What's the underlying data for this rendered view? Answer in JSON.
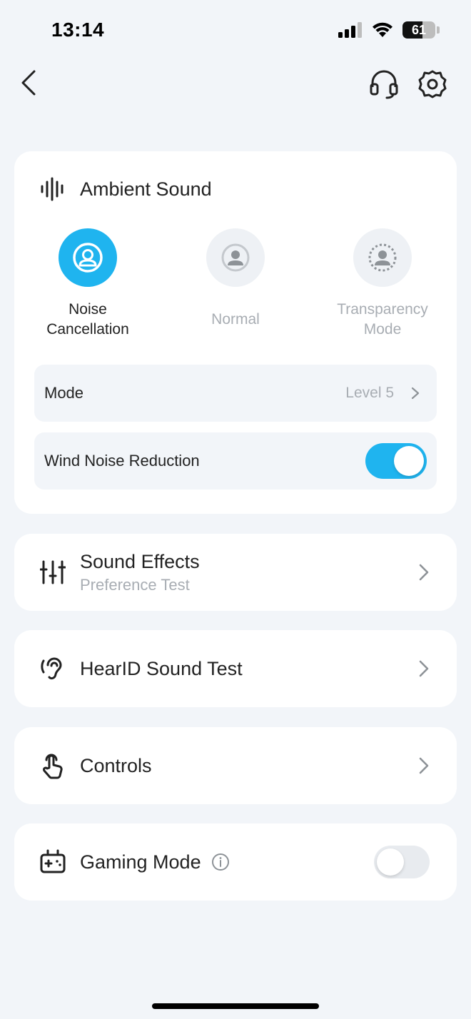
{
  "status_bar": {
    "time": "13:14",
    "battery": "61",
    "battery_level": 0.61
  },
  "nav": {
    "back_icon": "chevron-left-icon",
    "headset_icon": "headset-icon",
    "settings_icon": "gear-icon"
  },
  "ambient": {
    "title": "Ambient Sound",
    "modes": [
      {
        "line1": "Noise",
        "line2": "Cancellation",
        "selected": true
      },
      {
        "line1": "Normal",
        "line2": "",
        "selected": false
      },
      {
        "line1": "Transparency",
        "line2": "Mode",
        "selected": false
      }
    ],
    "mode_row": {
      "label": "Mode",
      "value": "Level 5"
    },
    "wind_row": {
      "label": "Wind Noise Reduction",
      "enabled": true
    }
  },
  "list": {
    "sound_effects": {
      "title": "Sound Effects",
      "subtitle": "Preference Test"
    },
    "hearid": {
      "title": "HearID Sound Test"
    },
    "controls": {
      "title": "Controls"
    },
    "gaming": {
      "title": "Gaming Mode",
      "enabled": false
    }
  },
  "colors": {
    "accent": "#1fb4ef",
    "background": "#f2f5f9",
    "muted_text": "#a8adb3"
  }
}
